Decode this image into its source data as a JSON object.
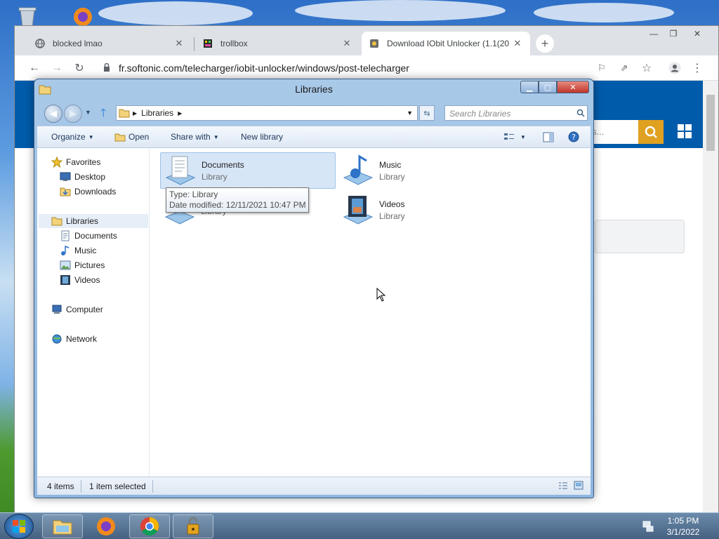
{
  "browser": {
    "tabs": [
      {
        "title": "blocked lmao",
        "close": "✕"
      },
      {
        "title": "trollbox",
        "close": "✕"
      },
      {
        "title": "Download IObit Unlocker (1.1(20",
        "close": "✕"
      }
    ],
    "new_tab": "+",
    "url": "fr.softonic.com/telecharger/iobit-unlocker/windows/post-telecharger",
    "search_partial": "s...",
    "controls": {
      "minimize": "—",
      "maximize": "❐",
      "close": "✕"
    }
  },
  "explorer": {
    "title": "Libraries",
    "address": "Libraries",
    "search_placeholder": "Search Libraries",
    "commands": {
      "organize": "Organize",
      "open": "Open",
      "share_with": "Share with",
      "new_library": "New library"
    },
    "nav": {
      "favorites": "Favorites",
      "desktop": "Desktop",
      "downloads": "Downloads",
      "libraries": "Libraries",
      "documents": "Documents",
      "music": "Music",
      "pictures": "Pictures",
      "videos": "Videos",
      "computer": "Computer",
      "network": "Network"
    },
    "items": [
      {
        "name": "Documents",
        "type": "Library"
      },
      {
        "name": "Music",
        "type": "Library"
      },
      {
        "name": "",
        "type": "Library"
      },
      {
        "name": "Videos",
        "type": "Library"
      }
    ],
    "tooltip": {
      "type": "Type: Library",
      "modified": "Date modified: 12/11/2021 10:47 PM"
    },
    "status": {
      "count": "4 items",
      "selected": "1 item selected"
    }
  },
  "taskbar": {
    "time": "1:05 PM",
    "date": "3/1/2022"
  },
  "colors": {
    "accent": "#005baa",
    "search_button": "#e0a020",
    "selection": "#d7e6f7"
  }
}
